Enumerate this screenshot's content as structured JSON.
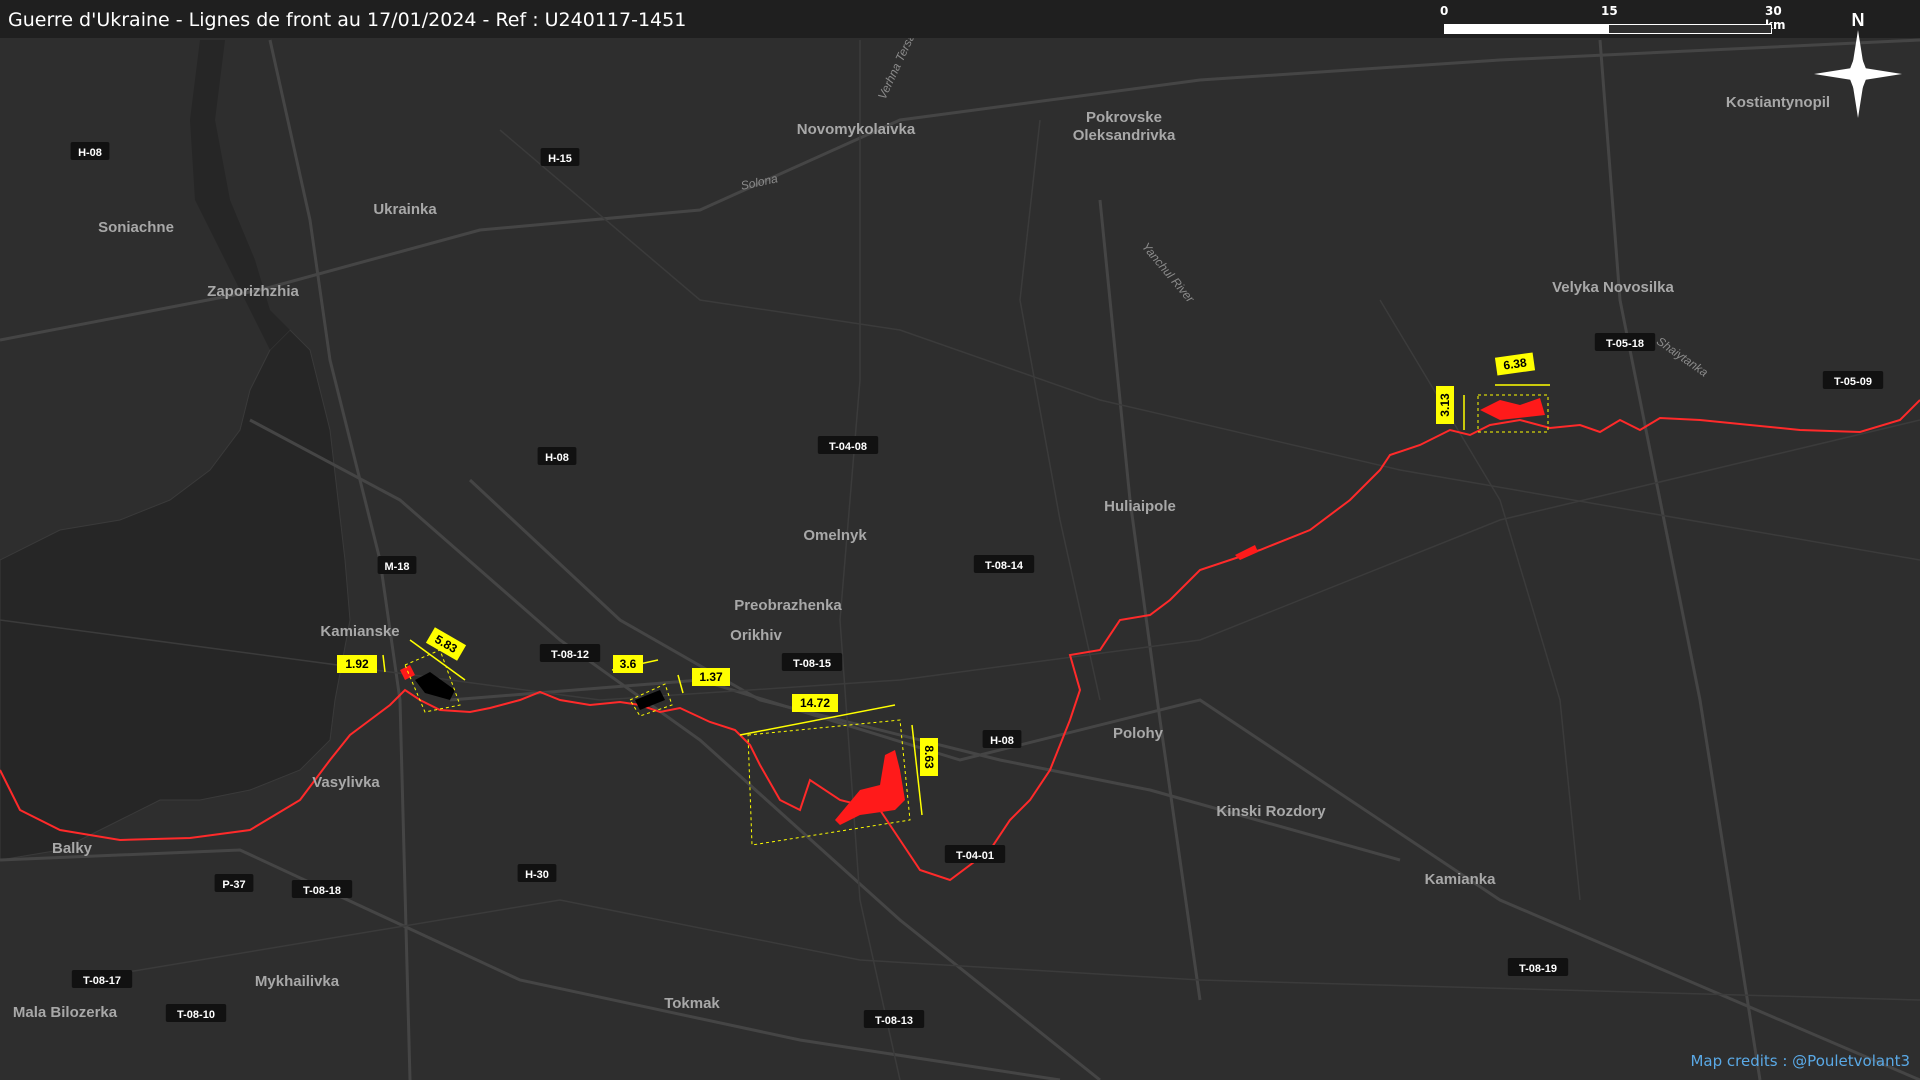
{
  "title": "Guerre d'Ukraine - Lignes de front au 17/01/2024 - Ref : U240117-1451",
  "scale": {
    "labels": [
      "0",
      "15",
      "30 km"
    ]
  },
  "north_label": "N",
  "credits": "Map credits : @Pouletvolant3",
  "colors": {
    "background": "#2e2e2e",
    "front_line": "#ff2a2a",
    "measure": "#ffff00",
    "road_label_bg": "#111111"
  },
  "cities": [
    "Zaporizhzhia",
    "Soniachne",
    "Ukrainka",
    "Novomykolaivka",
    "Pokrovske",
    "Oleksandrivka",
    "Kostiantynopil",
    "Velyka Novosilka",
    "Huliaipole",
    "Omelnyk",
    "Preobrazhenka",
    "Orikhiv",
    "Kamianske",
    "Vasylivka",
    "Balky",
    "Polohy",
    "Kinski Rozdory",
    "Kamianka",
    "Tokmak",
    "Mykhailivka",
    "Mala Bilozerka"
  ],
  "rivers": [
    "Verhna Tersa",
    "Solona",
    "Yanchul River",
    "Shaiytanka"
  ],
  "roads": [
    "H-08",
    "H-15",
    "H-08",
    "M-18",
    "T-04-08",
    "T-08-14",
    "T-08-12",
    "T-08-15",
    "H-08",
    "T-04-01",
    "H-30",
    "P-37",
    "T-08-18",
    "T-08-17",
    "T-08-10",
    "T-08-13",
    "T-08-19",
    "T-05-18",
    "T-05-09"
  ],
  "measures": [
    "1.92",
    "5.83",
    "3.6",
    "1.37",
    "14.72",
    "8.63",
    "6.38",
    "3.13"
  ]
}
